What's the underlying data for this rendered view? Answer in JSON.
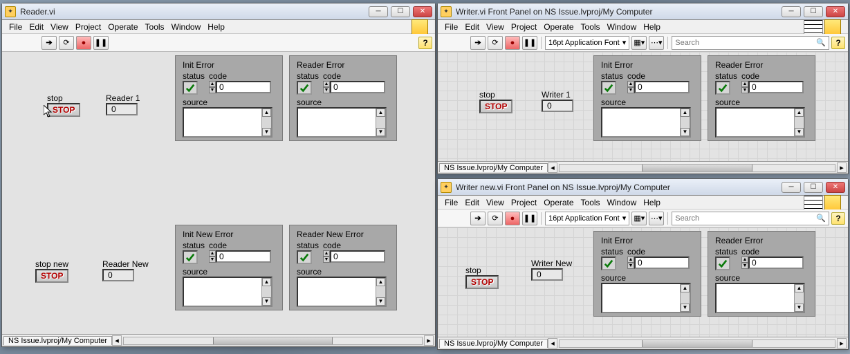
{
  "menus": [
    "File",
    "Edit",
    "View",
    "Project",
    "Operate",
    "Tools",
    "Window",
    "Help"
  ],
  "reader": {
    "title": "Reader.vi",
    "stop_label": "stop",
    "stop_btn": "STOP",
    "reader1_label": "Reader 1",
    "reader1_value": "0",
    "stopnew_label": "stop new",
    "stopnew_btn": "STOP",
    "readernew_label": "Reader New",
    "readernew_value": "0",
    "init_error": {
      "title": "Init Error",
      "status": "status",
      "code_label": "code",
      "code_value": "0",
      "source_label": "source"
    },
    "reader_error": {
      "title": "Reader Error",
      "status": "status",
      "code_label": "code",
      "code_value": "0",
      "source_label": "source"
    },
    "initnew_error": {
      "title": "Init New Error",
      "status": "status",
      "code_label": "code",
      "code_value": "0",
      "source_label": "source"
    },
    "readernew_error": {
      "title": "Reader New Error",
      "status": "status",
      "code_label": "code",
      "code_value": "0",
      "source_label": "source"
    },
    "status_tab": "NS Issue.lvproj/My Computer"
  },
  "writer": {
    "title": "Writer.vi Front Panel on NS Issue.lvproj/My Computer",
    "font_label": "16pt Application Font",
    "search_placeholder": "Search",
    "stop_label": "stop",
    "stop_btn": "STOP",
    "w1_label": "Writer 1",
    "w1_value": "0",
    "init_error": {
      "title": "Init Error",
      "status": "status",
      "code_label": "code",
      "code_value": "0",
      "source_label": "source"
    },
    "reader_error": {
      "title": "Reader Error",
      "status": "status",
      "code_label": "code",
      "code_value": "0",
      "source_label": "source"
    },
    "status_tab": "NS Issue.lvproj/My Computer"
  },
  "writernew": {
    "title": "Writer new.vi Front Panel on NS Issue.lvproj/My Computer",
    "font_label": "16pt Application Font",
    "search_placeholder": "Search",
    "stop_label": "stop",
    "stop_btn": "STOP",
    "wn_label": "Writer New",
    "wn_value": "0",
    "init_error": {
      "title": "Init Error",
      "status": "status",
      "code_label": "code",
      "code_value": "0",
      "source_label": "source"
    },
    "reader_error": {
      "title": "Reader Error",
      "status": "status",
      "code_label": "code",
      "code_value": "0",
      "source_label": "source"
    },
    "status_tab": "NS Issue.lvproj/My Computer"
  }
}
